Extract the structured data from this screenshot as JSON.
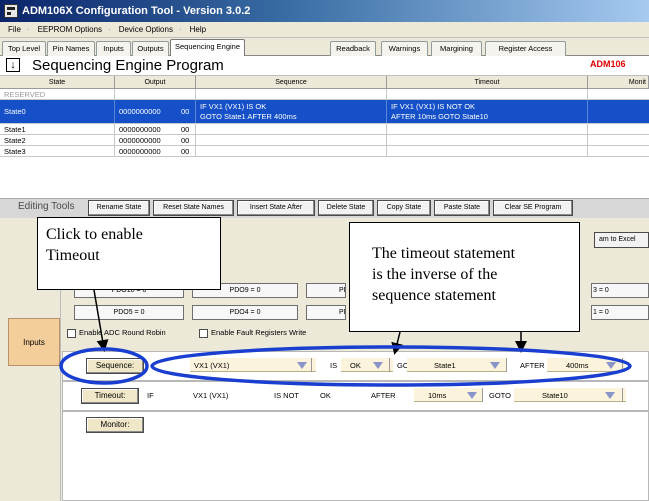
{
  "app": {
    "title": "ADM106X Configuration Tool - Version 3.0.2"
  },
  "menu": [
    "File",
    "EEPROM Options",
    "Device Options",
    "Help"
  ],
  "tabs": [
    {
      "label": "Top Level",
      "active": false
    },
    {
      "label": "Pin Names",
      "active": false
    },
    {
      "label": "Inputs",
      "active": false
    },
    {
      "label": "Outputs",
      "active": false
    },
    {
      "label": "Sequencing Engine",
      "active": true
    },
    {
      "label": "Readback",
      "active": false
    },
    {
      "label": "Warnings",
      "active": false
    },
    {
      "label": "Margining",
      "active": false
    },
    {
      "label": "Register Access",
      "active": false
    }
  ],
  "header": {
    "title": "Sequencing Engine Program",
    "device_label": "ADM106"
  },
  "grid": {
    "columns": [
      "State",
      "Output",
      "Sequence",
      "Timeout",
      "Monit"
    ],
    "rows": [
      {
        "state": "RESERVED",
        "output": "",
        "code": "",
        "sequence": [
          "",
          ""
        ],
        "timeout": [
          "",
          ""
        ],
        "kind": "reserved"
      },
      {
        "state": "State0",
        "output": "0000000000",
        "code": "00",
        "sequence": [
          "IF VX1 (VX1) IS OK",
          "GOTO State1 AFTER 400ms"
        ],
        "timeout": [
          "IF VX1 (VX1) IS NOT OK",
          "AFTER 10ms GOTO State10"
        ],
        "kind": "selected"
      },
      {
        "state": "State1",
        "output": "0000000000",
        "code": "00",
        "sequence": [
          "",
          ""
        ],
        "timeout": [
          "",
          ""
        ],
        "kind": "normal"
      },
      {
        "state": "State2",
        "output": "0000000000",
        "code": "00",
        "sequence": [
          "",
          ""
        ],
        "timeout": [
          "",
          ""
        ],
        "kind": "normal"
      },
      {
        "state": "State3",
        "output": "0000000000",
        "code": "00",
        "sequence": [
          "",
          ""
        ],
        "timeout": [
          "",
          ""
        ],
        "kind": "normal"
      }
    ]
  },
  "editing_tools": {
    "label": "Editing Tools",
    "buttons": [
      "Rename State",
      "Reset State Names",
      "Insert State After",
      "Delete State",
      "Copy State",
      "Paste State",
      "Clear SE Program"
    ]
  },
  "panel": {
    "state_fragment_top": "0",
    "state_fragment_mid": "0",
    "export_button": "am to Excel",
    "pdo_rows": [
      [
        "PDO10 = 0",
        "PDO9 = 0",
        "PD",
        "3 = 0"
      ],
      [
        "PDO5 = 0",
        "PDO4 = 0",
        "PD",
        "1 = 0"
      ]
    ],
    "checkbox_adc": "Enable ADC Round Robin",
    "checkbox_fault": "Enable Fault Registers Write",
    "sidebar_tab": "Inputs"
  },
  "sequence_row": {
    "button": "Sequence:",
    "signal": "VX1 (VX1)",
    "is_label": "IS",
    "condition": "OK",
    "goto_label": "GOTO",
    "target": "State1",
    "after_label": "AFTER",
    "delay": "400ms"
  },
  "timeout_row": {
    "button": "Timeout:",
    "if_label": "IF",
    "signal": "VX1 (VX1)",
    "is_not_label": "IS NOT",
    "condition": "OK",
    "after_label": "AFTER",
    "delay": "10ms",
    "goto_label": "GOTO",
    "target": "State10"
  },
  "monitor_row": {
    "button": "Monitor:"
  },
  "callouts": {
    "left": [
      "Click to enable",
      "Timeout"
    ],
    "right": [
      "The timeout statement",
      "is the inverse of the",
      "sequence statement"
    ]
  },
  "colors": {
    "selection": "#1550c8",
    "device_label": "#e00000",
    "inputs_tab": "#f3ce9a",
    "annotation_blue": "#1a3fd0"
  }
}
